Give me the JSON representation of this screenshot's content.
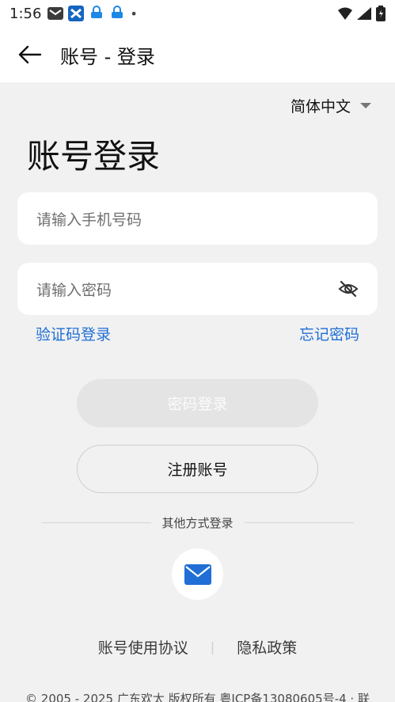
{
  "status_bar": {
    "time": "1:56",
    "dot": "•"
  },
  "app_bar": {
    "title": "账号 - 登录"
  },
  "language": {
    "label": "简体中文"
  },
  "headline": "账号登录",
  "phone_field": {
    "placeholder": "请输入手机号码"
  },
  "password_field": {
    "placeholder": "请输入密码"
  },
  "links": {
    "sms_login": "验证码登录",
    "forgot_password": "忘记密码"
  },
  "buttons": {
    "password_login": "密码登录",
    "register": "注册账号"
  },
  "other_methods": {
    "label": "其他方式登录"
  },
  "footer": {
    "agreement": "账号使用协议",
    "separator": "|",
    "privacy": "隐私政策",
    "copyright": "© 2005 - 2025 广东欢太 版权所有 粤ICP备13080605号-4 · 联"
  },
  "colors": {
    "accent_link": "#1f6fd6",
    "background": "#f1f1f1",
    "disabled_button": "#e4e4e4"
  }
}
